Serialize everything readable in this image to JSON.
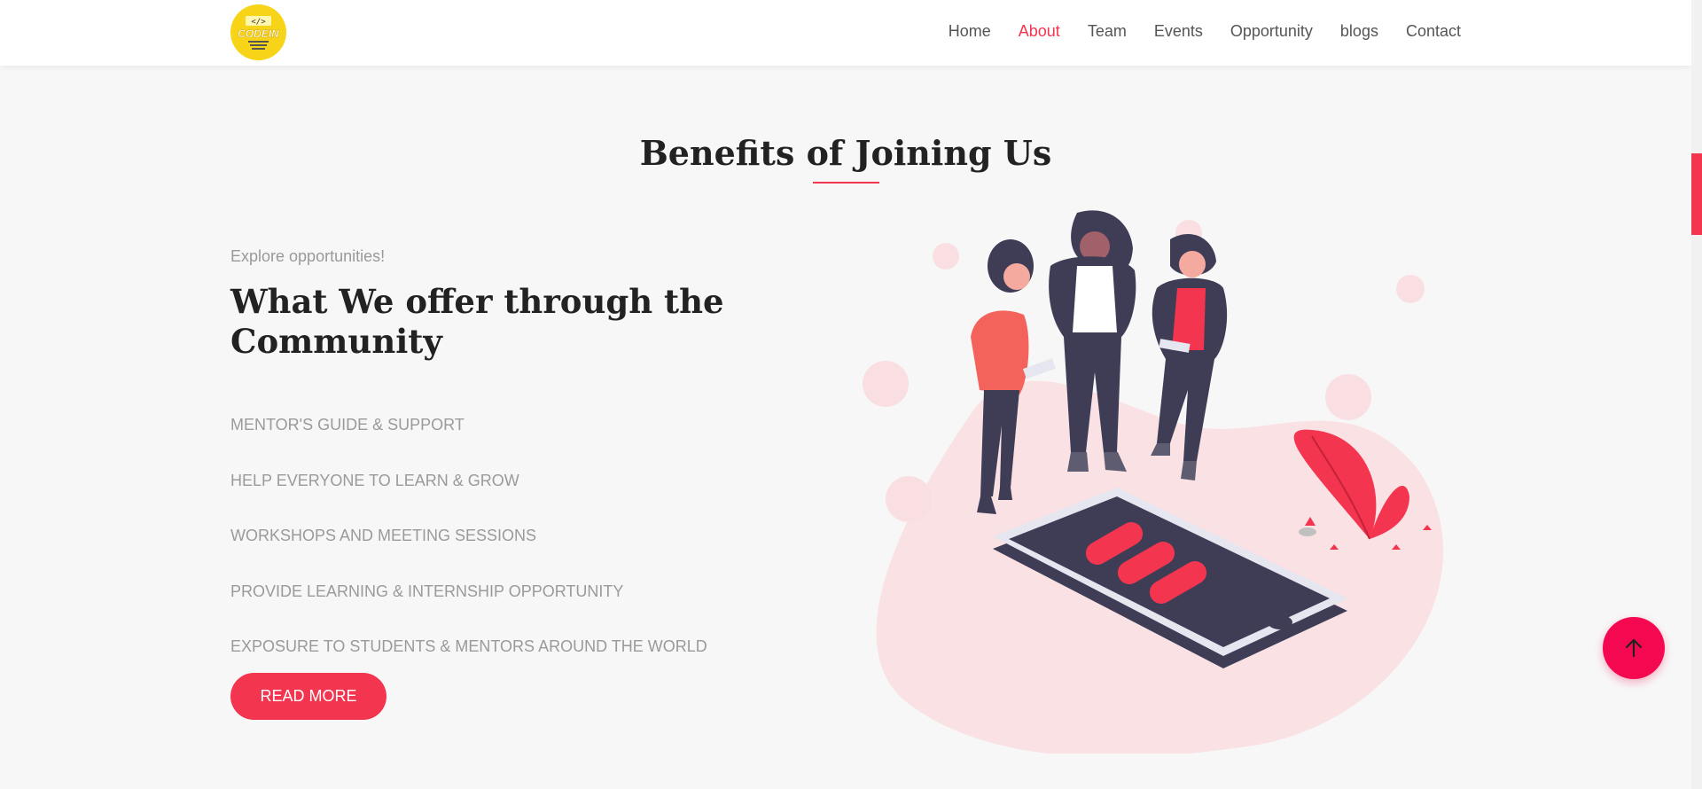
{
  "brand": {
    "logo_text": "CODEIN",
    "logo_code": "</>",
    "logo_tagline": "COMMUNITY OF CODING ENTHUSIASTS"
  },
  "nav": {
    "items": [
      "Home",
      "About",
      "Team",
      "Events",
      "Opportunity",
      "blogs",
      "Contact"
    ],
    "active": "About"
  },
  "section": {
    "title": "Benefits of Joining Us"
  },
  "offer": {
    "eyebrow": "Explore opportunities!",
    "heading": "What We offer through the Community",
    "benefits": [
      "MENTOR'S GUIDE & SUPPORT",
      "HELP EVERYONE TO LEARN & GROW",
      "WORKSHOPS AND MEETING SESSIONS",
      "PROVIDE LEARNING & INTERNSHIP OPPORTUNITY",
      "EXPOSURE TO STUDENTS & MENTORS AROUND THE WORLD"
    ],
    "button_label": "READ MORE"
  },
  "icons": {
    "back_to_top": "arrow-up-icon"
  },
  "colors": {
    "accent": "#f4354f",
    "logo_bg": "#f7d417",
    "dark": "#3f3d56",
    "text": "#222222",
    "muted": "#9a9a9a"
  }
}
